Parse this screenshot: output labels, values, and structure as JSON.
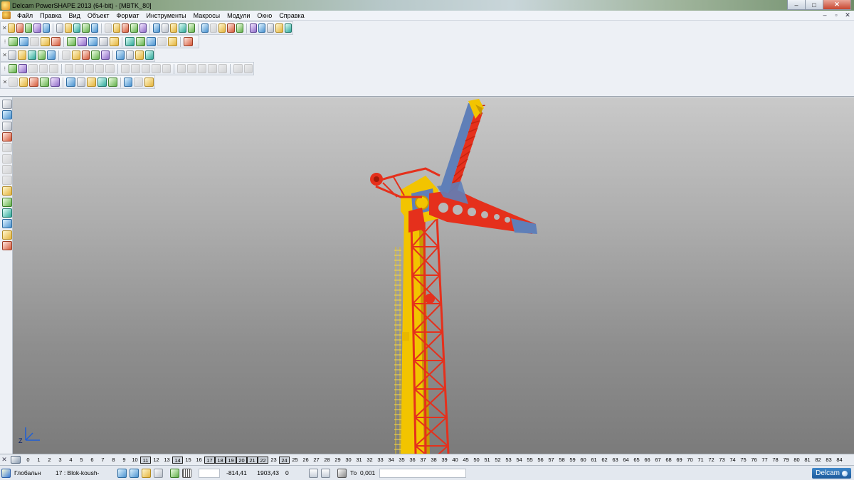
{
  "window": {
    "title": "Delcam PowerSHAPE 2013 (64-bit) - [MBTK_80]",
    "controls": [
      "–",
      "□",
      "✕"
    ]
  },
  "menu": {
    "items": [
      "Файл",
      "Правка",
      "Вид",
      "Объект",
      "Формат",
      "Инструменты",
      "Макросы",
      "Модули",
      "Окно",
      "Справка"
    ],
    "mdi_controls": [
      "–",
      "▫",
      "✕"
    ]
  },
  "toolbars": {
    "rows": [
      {
        "name": "standard",
        "button_count": 30
      },
      {
        "name": "view",
        "button_count": 16
      },
      {
        "name": "objects",
        "button_count": 14
      },
      {
        "name": "shading",
        "button_count": 22
      },
      {
        "name": "selection",
        "button_count": 13
      }
    ]
  },
  "left_toolbar": {
    "icons": [
      "select-arrow-icon",
      "layers-icon",
      "line-icon",
      "warning-icon",
      "curve-icon",
      "edit-icon",
      "edit2-icon",
      "edit3-icon",
      "star-icon",
      "surface-icon",
      "solid-icon",
      "assembly-icon",
      "box-icon",
      "tool-icon"
    ]
  },
  "viewport": {
    "axis_label": "Z",
    "colors": {
      "tower_yellow": "#f2c400",
      "lattice_red": "#e5301c",
      "steel_blue": "#5f7fb8"
    }
  },
  "layer_bar": {
    "numbers": [
      "0",
      "1",
      "2",
      "3",
      "4",
      "5",
      "6",
      "7",
      "8",
      "9",
      "10",
      "11",
      "12",
      "13",
      "14",
      "15",
      "16",
      "17",
      "18",
      "19",
      "20",
      "21",
      "22",
      "23",
      "24",
      "25",
      "26",
      "27",
      "28",
      "29",
      "30",
      "31",
      "32",
      "33",
      "34",
      "35",
      "36",
      "37",
      "38",
      "39",
      "40",
      "45",
      "50",
      "51",
      "52",
      "53",
      "54",
      "55",
      "56",
      "57",
      "58",
      "59",
      "60",
      "61",
      "62",
      "63",
      "64",
      "65",
      "66",
      "67",
      "68",
      "69",
      "70",
      "71",
      "72",
      "73",
      "74",
      "75",
      "76",
      "77",
      "78",
      "79",
      "80",
      "81",
      "82",
      "83",
      "84"
    ],
    "active": [
      "11",
      "14",
      "17",
      "18",
      "19",
      "20",
      "21",
      "22",
      "24"
    ]
  },
  "status": {
    "workplane_label": "Глобальн",
    "level_label": "17 : Blok-koush-",
    "x_value": "-814,41",
    "y_value": "1903,43",
    "z_value": "0",
    "tolerance_label": "То",
    "tolerance_value": "0,001",
    "brand": "Delcam"
  }
}
